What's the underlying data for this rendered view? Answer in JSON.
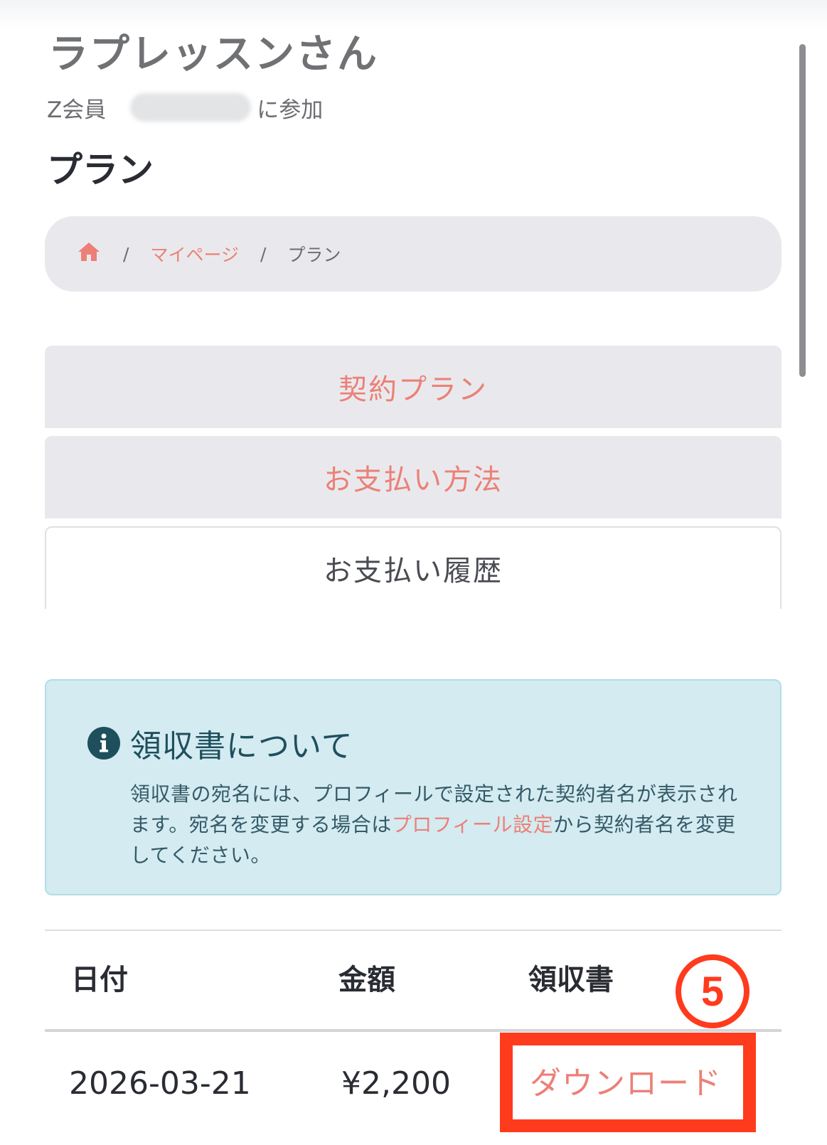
{
  "profile": {
    "name": "ラプレッスンさん",
    "member_type": "Z会員",
    "joined_suffix": "に参加"
  },
  "page": {
    "title": "プラン"
  },
  "breadcrumb": {
    "home_icon": "home-icon",
    "separator": "/",
    "mypage": "マイページ",
    "current": "プラン"
  },
  "tabs": [
    {
      "label": "契約プラン",
      "active": false
    },
    {
      "label": "お支払い方法",
      "active": false
    },
    {
      "label": "お支払い履歴",
      "active": true
    }
  ],
  "alert": {
    "icon": "info-icon",
    "title": "領収書について",
    "body_part1": "領収書の宛名には、プロフィールで設定された契約者名が表示されます。宛名を変更する場合は",
    "link_text": "プロフィール設定",
    "body_part2": "から契約者名を変更してください。"
  },
  "table": {
    "headers": [
      "日付",
      "金額",
      "領収書"
    ],
    "rows": [
      {
        "date": "2026-03-21",
        "amount": "¥2,200",
        "receipt": "ダウンロード"
      }
    ]
  },
  "annotation": {
    "step_number": "5",
    "color": "#ff3b1d"
  },
  "colors": {
    "accent": "#ec8077",
    "alert_bg": "#d3ebf1",
    "tab_bg": "#e9e9ed"
  }
}
